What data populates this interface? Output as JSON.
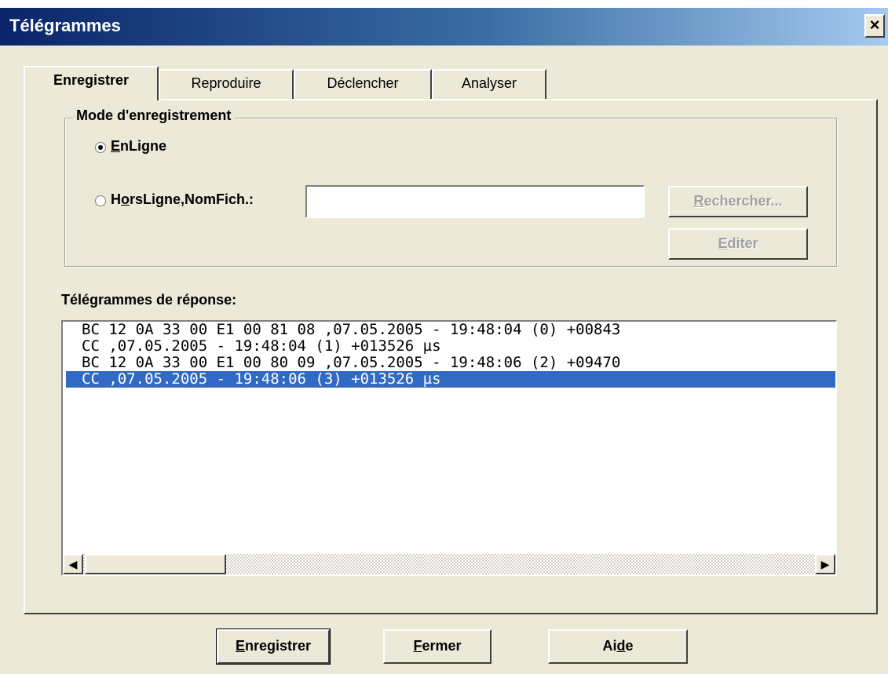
{
  "window": {
    "title": "Télégrammes",
    "close_icon": "close-icon"
  },
  "tabs": [
    {
      "label": "Enregistrer",
      "active": true
    },
    {
      "label": "Reproduire",
      "active": false
    },
    {
      "label": "Déclencher",
      "active": false
    },
    {
      "label": "Analyser",
      "active": false
    }
  ],
  "record_mode": {
    "legend": "Mode d'enregistrement",
    "online": {
      "mn": "E",
      "rest": "nLigne",
      "selected": true
    },
    "offline": {
      "pre": "H",
      "mn": "o",
      "rest": "rsLigne,NomFich.:",
      "selected": false
    },
    "filename_value": "",
    "search_button": {
      "mn": "R",
      "rest": "echercher..."
    },
    "edit_button": {
      "mn": "E",
      "rest": "diter"
    }
  },
  "responses": {
    "label": "Télégrammes de réponse:",
    "rows": [
      "BC 12 0A 33 00 E1 00 81 08 ,07.05.2005 - 19:48:04 (0) +00843",
      "CC ,07.05.2005 - 19:48:04 (1) +013526 µs",
      "BC 12 0A 33 00 E1 00 80 09 ,07.05.2005 - 19:48:06 (2) +09470",
      "CC ,07.05.2005 - 19:48:06 (3) +013526 µs"
    ],
    "selected_index": 3
  },
  "footer": {
    "record": {
      "mn": "E",
      "rest": "nregistrer"
    },
    "close": {
      "mn": "F",
      "rest": "ermer"
    },
    "help": {
      "pre": "Ai",
      "mn": "d",
      "rest": "e"
    }
  }
}
